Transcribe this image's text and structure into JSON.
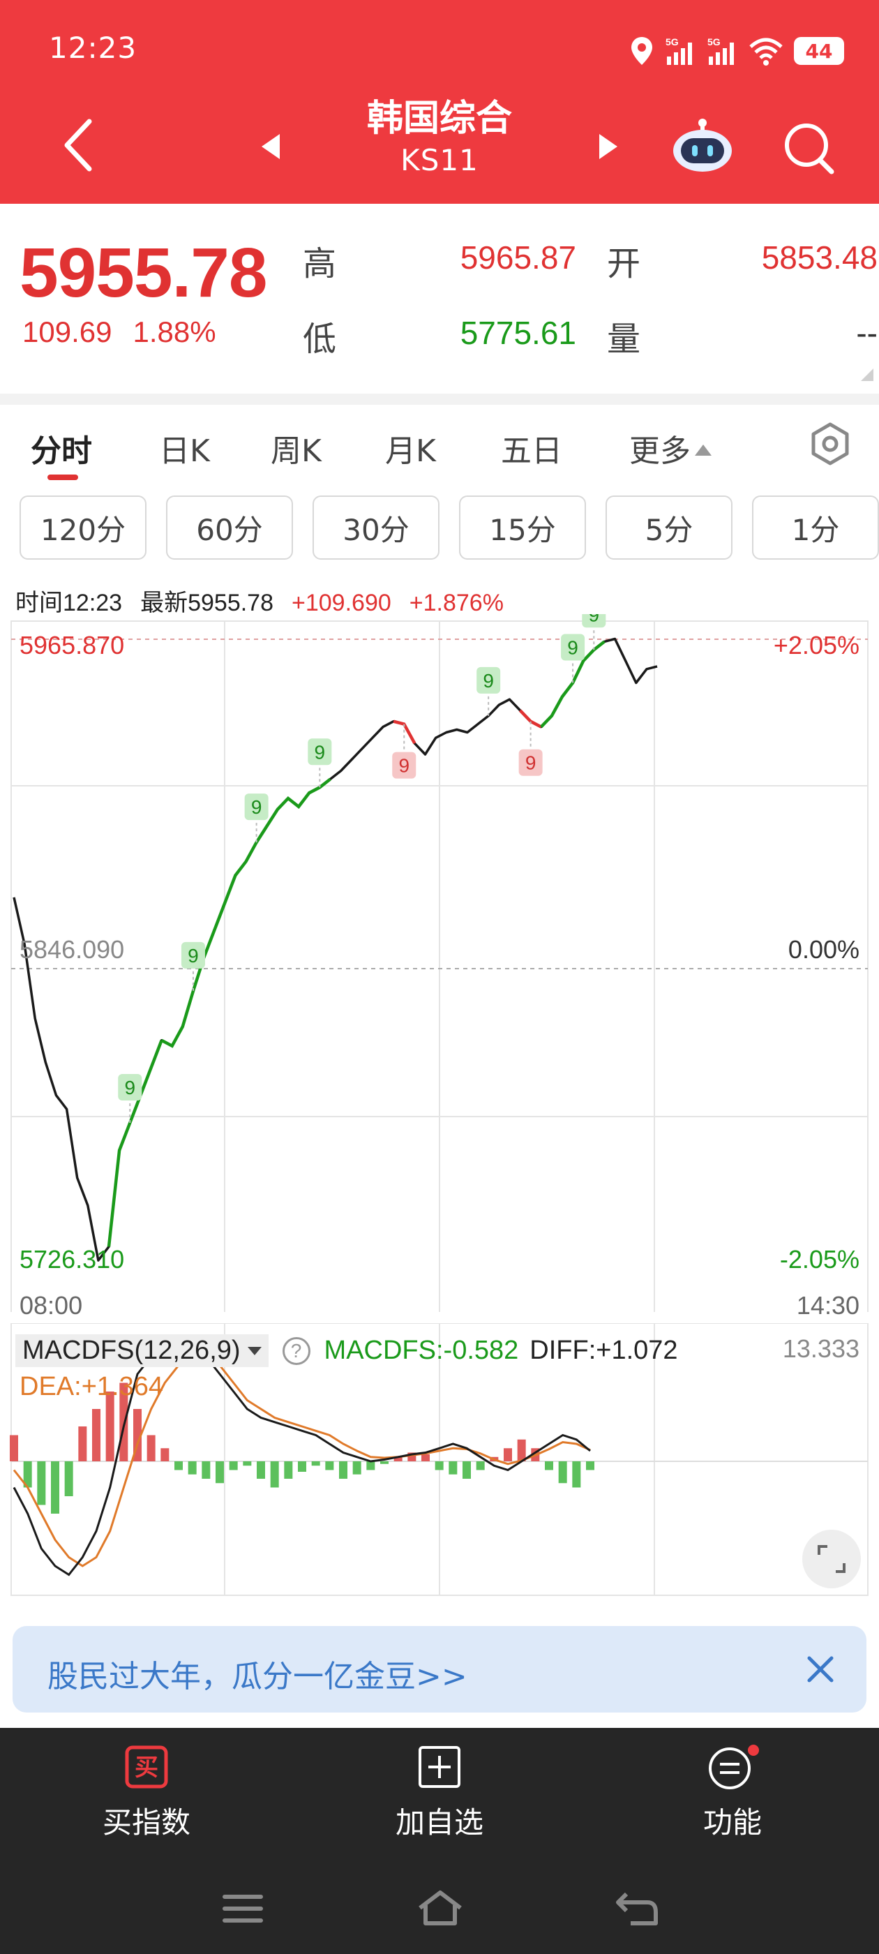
{
  "status_bar": {
    "time": "12:23",
    "network_1": "5G",
    "network_2": "5G",
    "battery": "44"
  },
  "header": {
    "title": "韩国综合",
    "code": "KS11"
  },
  "quote": {
    "last": "5955.78",
    "change": "109.69",
    "change_pct": "1.88%",
    "high_label": "高",
    "high_value": "5965.87",
    "low_label": "低",
    "low_value": "5775.61",
    "open_label": "开",
    "open_value": "5853.48",
    "volume_label": "量",
    "volume_value": "--"
  },
  "tabs": [
    "分时",
    "日K",
    "周K",
    "月K",
    "五日",
    "更多"
  ],
  "active_tab": "分时",
  "interval_tabs": [
    "120分",
    "60分",
    "30分",
    "15分",
    "5分",
    "1分"
  ],
  "chart_info": {
    "time": "时间12:23",
    "latest": "最新5955.78",
    "change": "+109.690",
    "change_pct": "+1.876%"
  },
  "chart_data": {
    "type": "line",
    "prev_close": 5846.09,
    "ylim": [
      5726.31,
      5965.87
    ],
    "ytick_left": {
      "top": "5965.870",
      "mid": "5846.090",
      "bottom": "5726.310"
    },
    "ytick_right": {
      "top": "+2.05%",
      "mid": "0.00%",
      "bottom": "-2.05%"
    },
    "x_start": "08:00",
    "x_end": "14:30",
    "series": [
      {
        "values": [
          5872,
          5855,
          5828,
          5812,
          5800,
          5795,
          5770,
          5760,
          5740,
          5745,
          5780,
          5790,
          5800,
          5810,
          5820,
          5818,
          5825,
          5838,
          5850,
          5860,
          5870,
          5880,
          5885,
          5892,
          5898,
          5904,
          5908,
          5905,
          5910,
          5912,
          5915,
          5918,
          5922,
          5926,
          5930,
          5934,
          5936,
          5935,
          5928,
          5924,
          5930,
          5932,
          5933,
          5932,
          5935,
          5938,
          5942,
          5944,
          5940,
          5936,
          5934,
          5938,
          5945,
          5950,
          5958,
          5962,
          5965,
          5966,
          5958,
          5950,
          5955,
          5956
        ]
      }
    ],
    "signals": [
      {
        "label": "9",
        "type": "buy",
        "index": 11
      },
      {
        "label": "9",
        "type": "buy",
        "index": 17
      },
      {
        "label": "9",
        "type": "buy",
        "index": 23
      },
      {
        "label": "9",
        "type": "buy",
        "index": 29
      },
      {
        "label": "9",
        "type": "sell",
        "index": 37
      },
      {
        "label": "9",
        "type": "buy",
        "index": 45
      },
      {
        "label": "9",
        "type": "sell",
        "index": 49
      },
      {
        "label": "9",
        "type": "buy",
        "index": 53
      },
      {
        "label": "9",
        "type": "buy",
        "index": 55
      }
    ],
    "macd": {
      "name": "MACDFS(12,26,9)",
      "value": "MACDFS:-0.582",
      "diff": "DIFF:+1.072",
      "dea": "DEA:+1.364",
      "scale_top": "13.333",
      "diff_values": [
        -3,
        -6,
        -10,
        -12,
        -13,
        -11,
        -8,
        -3,
        4,
        10,
        12,
        13,
        13.5,
        13,
        12,
        10,
        8,
        6,
        5,
        4.5,
        4,
        3.5,
        3,
        2,
        1,
        0.5,
        0,
        0.2,
        0.5,
        0.8,
        1,
        1.5,
        2,
        1.5,
        0.5,
        -0.5,
        -1,
        0,
        1,
        2,
        3,
        2.5,
        1.2
      ],
      "dea_values": [
        -1,
        -3,
        -6,
        -9,
        -11,
        -12,
        -11,
        -8,
        -3,
        2,
        6,
        9,
        11,
        12,
        12.5,
        11,
        9,
        7,
        6,
        5,
        4.5,
        4,
        3.5,
        3,
        2,
        1.2,
        0.5,
        0.4,
        0.5,
        0.7,
        0.9,
        1.2,
        1.5,
        1.4,
        0.9,
        0.2,
        -0.3,
        0.1,
        0.7,
        1.4,
        2.2,
        2.0,
        1.3
      ],
      "hist_values": [
        3,
        -3,
        -5,
        -6,
        -4,
        4,
        6,
        8,
        9,
        6,
        3,
        1.5,
        -1,
        -1.5,
        -2,
        -2.5,
        -1,
        -0.5,
        -2,
        -3,
        -2,
        -1.2,
        -0.5,
        -1,
        -2,
        -1.5,
        -1,
        -0.3,
        0.5,
        1,
        0.8,
        -1,
        -1.5,
        -2,
        -1,
        0.5,
        1.5,
        2.5,
        1.5,
        -1,
        -2.5,
        -3,
        -1
      ]
    }
  },
  "banner": {
    "text": "股民过大年，瓜分一亿金豆>>"
  },
  "bottom_bar": {
    "buy": "买指数",
    "buy_icon": "买",
    "add": "加自选",
    "func": "功能"
  },
  "colors": {
    "brand": "#ee3a3f",
    "up": "#e03232",
    "down": "#1a9a1a",
    "dea": "#e07a2a"
  }
}
